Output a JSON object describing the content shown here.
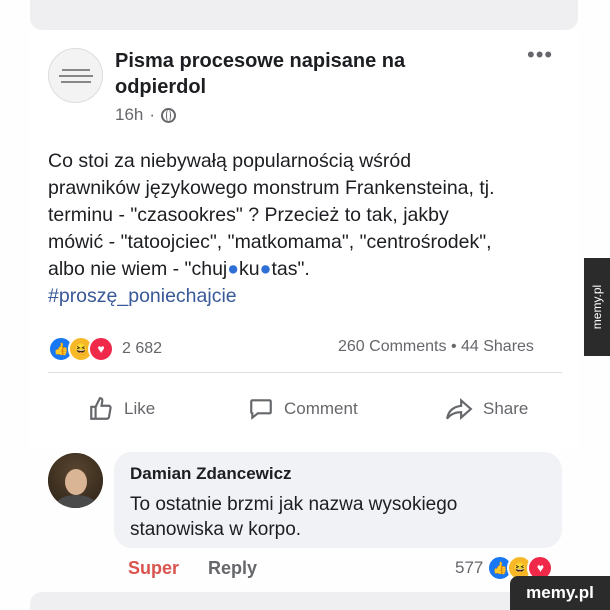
{
  "post": {
    "page_name": "Pisma procesowe napisane na odpierdol",
    "time": "16h",
    "separator": "·",
    "more": "•••",
    "text_lines": [
      "Co stoi za niebywałą popularnością wśród",
      "prawników językowego monstrum Frankensteina, tj.",
      "terminu - \"czasookres\" ? Przecież to tak, jakby",
      "mówić - \"tatoojciec\", \"matkomama\", \"centrośrodek\","
    ],
    "last_line_before": "albo nie wiem - \"chuj",
    "last_line_blob1": "●",
    "last_line_mid": "ku",
    "last_line_blob2": "●",
    "last_line_after": "tas\".",
    "hashtag": "#proszę_poniechajcie",
    "reaction_count": "2 682",
    "stats": "260 Comments • 44 Shares"
  },
  "actions": {
    "like": "Like",
    "comment": "Comment",
    "share": "Share"
  },
  "comment": {
    "author": "Damian Zdancewicz",
    "text": "To ostatnie brzmi jak nazwa wysokiego stanowiska w korpo.",
    "reaction_label": "Super",
    "reply_label": "Reply",
    "reaction_count": "577"
  },
  "watermark": {
    "side": "memy.pl",
    "bottom": "memy.pl"
  },
  "colors": {
    "accent": "#1877f2",
    "hashtag": "#385898",
    "super": "#d9534f"
  }
}
